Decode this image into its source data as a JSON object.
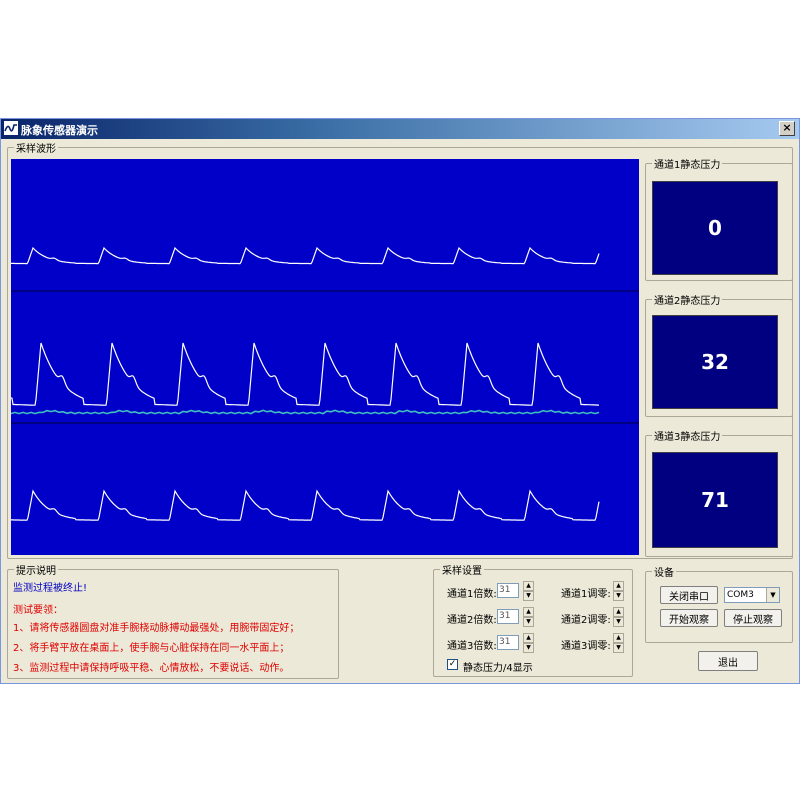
{
  "window": {
    "title": "脉象传感器演示",
    "close_label": "×"
  },
  "waveform": {
    "group_label": "采样波形"
  },
  "channels": [
    {
      "label": "通道1静态压力",
      "value": "0"
    },
    {
      "label": "通道2静态压力",
      "value": "32"
    },
    {
      "label": "通道3静态压力",
      "value": "71"
    }
  ],
  "hints": {
    "group_label": "提示说明",
    "status": "监测过程被终止!",
    "requirements_title": "测试要领：",
    "items": [
      "1、请将传感器圆盘对准手腕桡动脉搏动最强处，用腕带固定好；",
      "2、将手臂平放在桌面上，使手腕与心脏保持在同一水平面上；",
      "3、监测过程中请保持呼吸平稳、心情放松，不要说话、动作。"
    ]
  },
  "sampling": {
    "group_label": "采样设置",
    "gains": [
      {
        "label": "通道1倍数:",
        "value": "31"
      },
      {
        "label": "通道2倍数:",
        "value": "31"
      },
      {
        "label": "通道3倍数:",
        "value": "31"
      }
    ],
    "zeros": [
      {
        "label": "通道1调零:"
      },
      {
        "label": "通道2调零:"
      },
      {
        "label": "通道3调零:"
      }
    ],
    "static_checkbox_label": "静态压力/4显示",
    "static_checked": "✓"
  },
  "device": {
    "group_label": "设备",
    "close_port": "关闭串口",
    "port_value": "COM3",
    "start": "开始观察",
    "stop": "停止观察"
  },
  "exit_label": "退出",
  "colors": {
    "wave_bg": "#0000c8",
    "pressure_bg": "#000080",
    "trace": "#ffffff",
    "baseline": "#40c0c0"
  }
}
